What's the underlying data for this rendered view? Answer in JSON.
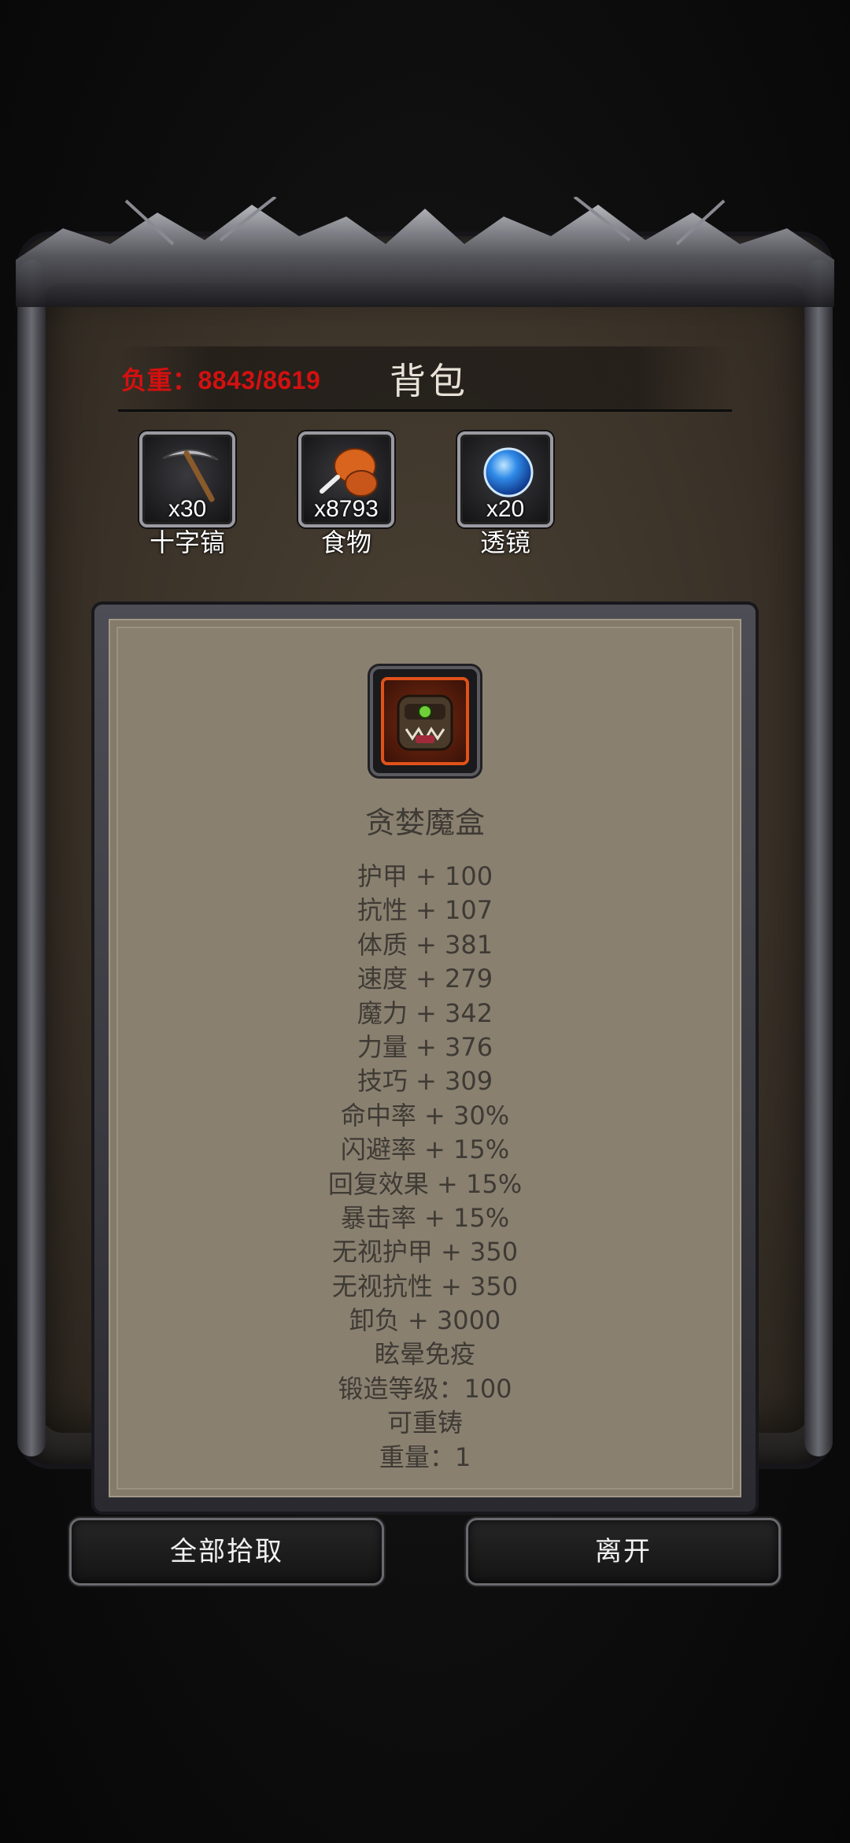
{
  "header": {
    "weight_label": "负重：8843/8619",
    "title": "背包"
  },
  "inventory": [
    {
      "icon": "pickaxe-icon",
      "count": "x30",
      "name": "十字镐"
    },
    {
      "icon": "food-drumstick-icon",
      "count": "x8793",
      "name": "食物"
    },
    {
      "icon": "lens-orb-icon",
      "count": "x20",
      "name": "透镜"
    }
  ],
  "detail": {
    "icon": "demon-box-icon",
    "name": "贪婪魔盒",
    "stats": [
      "护甲 + 100",
      "抗性 + 107",
      "体质 + 381",
      "速度 + 279",
      "魔力 + 342",
      "力量 + 376",
      "技巧 + 309",
      "命中率 + 30%",
      "闪避率 + 15%",
      "回复效果 + 15%",
      "暴击率 + 15%",
      "无视护甲 + 350",
      "无视抗性 + 350",
      "卸负 + 3000",
      "眩晕免疫",
      "锻造等级：100",
      "可重铸",
      "重量：1"
    ]
  },
  "buttons": {
    "pickup_all": "全部拾取",
    "leave": "离开"
  },
  "colors": {
    "weight_red": "#d41010",
    "rarity_orange": "#e0521a",
    "panel_parchment": "#8a8070"
  }
}
